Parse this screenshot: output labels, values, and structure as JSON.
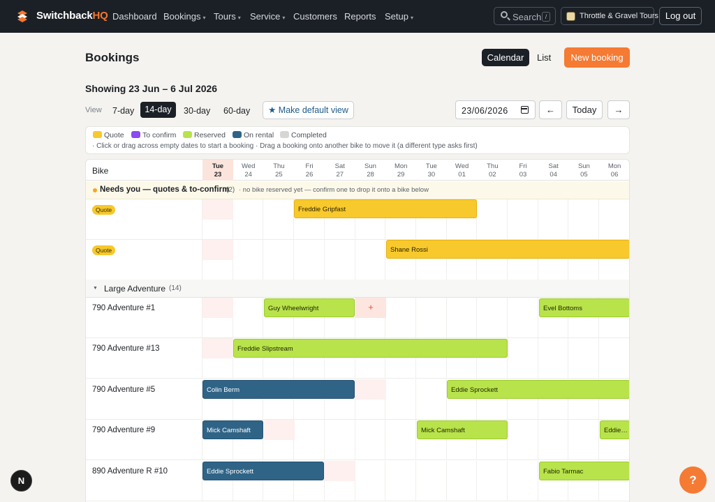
{
  "nav": {
    "brand_main": "Switchback",
    "brand_accent": "HQ",
    "items": [
      {
        "label": "Dashboard",
        "caret": ""
      },
      {
        "label": "Bookings",
        "caret": "▾"
      },
      {
        "label": "Tours",
        "caret": "▾"
      },
      {
        "label": "Service",
        "caret": "▾"
      },
      {
        "label": "Customers",
        "caret": ""
      },
      {
        "label": "Reports",
        "caret": ""
      },
      {
        "label": "Setup",
        "caret": "▾"
      }
    ],
    "search_label": "Search",
    "search_shortcut": "/",
    "org_name": "Throttle & Gravel Tours",
    "logout_label": "Log out"
  },
  "page": {
    "title": "Bookings",
    "calendar_label": "Calendar",
    "list_label": "List",
    "new_booking_label": "New booking",
    "showing": "Showing 23 Jun – 6 Jul 2026",
    "view_label": "View",
    "view_options": [
      "7-day",
      "14-day",
      "30-day",
      "60-day"
    ],
    "active_view": "14-day",
    "make_default_label": "★ Make default view",
    "date_value": "23/06/2026",
    "prev_label": "←",
    "today_label": "Today",
    "next_label": "→"
  },
  "legend": {
    "items": [
      {
        "label": "Quote",
        "color": "#f8c92c"
      },
      {
        "label": "To confirm",
        "color": "#8a4bf0"
      },
      {
        "label": "Reserved",
        "color": "#b9e34b"
      },
      {
        "label": "On rental",
        "color": "#2f6487"
      },
      {
        "label": "Completed",
        "color": "#d6d6d4"
      }
    ],
    "hint": "· Click or drag across empty dates to start a booking · Drag a booking onto another bike to move it (a different type asks first)"
  },
  "grid": {
    "bike_header": "Bike",
    "days": [
      {
        "name": "Tue",
        "date": "23"
      },
      {
        "name": "Wed",
        "date": "24"
      },
      {
        "name": "Thu",
        "date": "25"
      },
      {
        "name": "Fri",
        "date": "26"
      },
      {
        "name": "Sat",
        "date": "27"
      },
      {
        "name": "Sun",
        "date": "28"
      },
      {
        "name": "Mon",
        "date": "29"
      },
      {
        "name": "Tue",
        "date": "30"
      },
      {
        "name": "Wed",
        "date": "01"
      },
      {
        "name": "Thu",
        "date": "02"
      },
      {
        "name": "Fri",
        "date": "03"
      },
      {
        "name": "Sat",
        "date": "04"
      },
      {
        "name": "Sun",
        "date": "05"
      },
      {
        "name": "Mon",
        "date": "06"
      }
    ],
    "needs_title": "Needs you — quotes & to-confirm",
    "needs_count": "(2)",
    "needs_note": "· no bike reserved yet — confirm one to drop it onto a bike below",
    "quote_rows": [
      {
        "badge": "Quote",
        "bookings": [
          {
            "name": "Freddie Gripfast",
            "status": "quote"
          }
        ]
      },
      {
        "badge": "Quote",
        "bookings": [
          {
            "name": "Shane Rossi",
            "status": "quote"
          }
        ]
      }
    ],
    "group": {
      "name": "Large Adventure",
      "count": "(14)",
      "caret": "▼"
    },
    "bike_rows": [
      {
        "bike": "790 Adventure #1",
        "bookings": [
          {
            "name": "Guy Wheelwright",
            "status": "reserved"
          },
          {
            "name": "Evel Bottoms",
            "status": "reserved"
          }
        ]
      },
      {
        "bike": "790 Adventure #13",
        "bookings": [
          {
            "name": "Freddie Slipstream",
            "status": "reserved"
          }
        ]
      },
      {
        "bike": "790 Adventure #5",
        "bookings": [
          {
            "name": "Colin Berm",
            "status": "rental"
          },
          {
            "name": "Eddie Sprockett",
            "status": "reserved"
          }
        ]
      },
      {
        "bike": "790 Adventure #9",
        "bookings": [
          {
            "name": "Mick Camshaft",
            "status": "rental"
          },
          {
            "name": "Mick Camshaft",
            "status": "reserved"
          },
          {
            "name": "Eddie Sprockett",
            "status": "reserved"
          }
        ]
      },
      {
        "bike": "890 Adventure R #10",
        "bookings": [
          {
            "name": "Eddie Sprockett",
            "status": "rental"
          },
          {
            "name": "Fabio Tarmac",
            "status": "reserved"
          }
        ]
      }
    ],
    "add_glyph": "+"
  },
  "help_label": "?",
  "dev_badge": "N"
}
